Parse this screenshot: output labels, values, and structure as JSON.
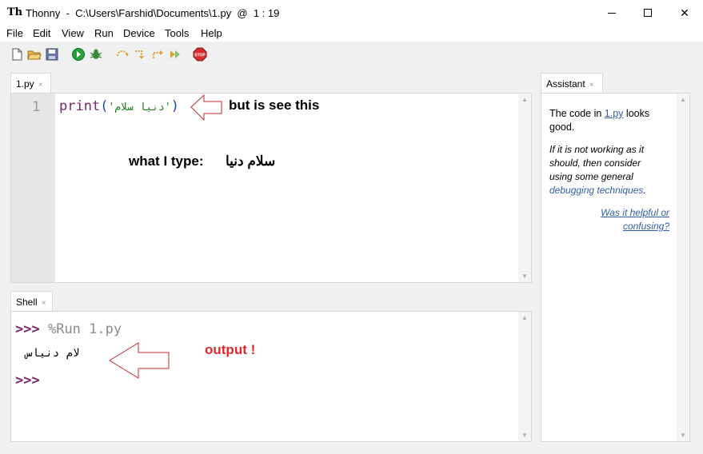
{
  "window": {
    "title": "Thonny  -  C:\\Users\\Farshid\\Documents\\1.py  @  1 : 19",
    "minimize": "—",
    "maximize": "☐",
    "close": "✕"
  },
  "menu": [
    "File",
    "Edit",
    "View",
    "Run",
    "Device",
    "Tools",
    "Help"
  ],
  "toolbar": [
    {
      "icon": "new-file-icon"
    },
    {
      "icon": "open-file-icon"
    },
    {
      "icon": "save-icon"
    },
    {
      "icon": "run-icon"
    },
    {
      "icon": "debug-icon"
    },
    {
      "icon": "step-over-icon"
    },
    {
      "icon": "step-into-icon"
    },
    {
      "icon": "step-out-icon"
    },
    {
      "icon": "resume-icon"
    },
    {
      "icon": "stop-icon"
    }
  ],
  "editor": {
    "tab_label": "1.py",
    "line_number": "1",
    "code_keyword": "print",
    "code_open": "(",
    "code_string": "'دنیا سلام'",
    "code_close": ")",
    "annotation_right": "but is see this",
    "annotation_typed_label": "what I type:",
    "annotation_typed_text": "سلام دنیا"
  },
  "shell": {
    "tab_label": "Shell",
    "prompt": ">>>",
    "command": "%Run 1.py",
    "output": "لام دنیاس",
    "annotation": "output !"
  },
  "assistant": {
    "tab_label": "Assistant",
    "line1_pre": "The code in ",
    "line1_link": "1.py",
    "line1_post": " looks good.",
    "para2": "If it is not working as it should, then consider using some general ",
    "para2_link": "debugging techniques",
    "para2_end": ".",
    "feedback_link": "Was it helpful or confusing?"
  },
  "colors": {
    "keyword": "#7a2470",
    "paren": "#1f3fbf",
    "string": "#1a7f1a",
    "annotation_red": "#e0252b",
    "link": "#2f5ea8"
  }
}
